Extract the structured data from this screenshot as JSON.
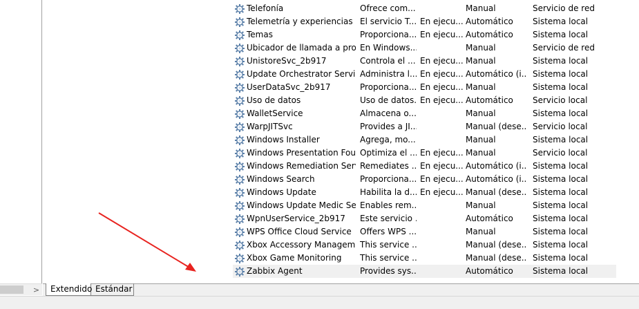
{
  "services": [
    {
      "name": "Telefonía",
      "description": "Ofrece com...",
      "state": "",
      "startup": "Manual",
      "logon": "Servicio de red"
    },
    {
      "name": "Telemetría y experiencias de...",
      "description": "El servicio T...",
      "state": "En ejecu...",
      "startup": "Automático",
      "logon": "Sistema local"
    },
    {
      "name": "Temas",
      "description": "Proporciona...",
      "state": "En ejecu...",
      "startup": "Automático",
      "logon": "Sistema local"
    },
    {
      "name": "Ubicador de llamada a proc...",
      "description": "En Windows...",
      "state": "",
      "startup": "Manual",
      "logon": "Servicio de red"
    },
    {
      "name": "UnistoreSvc_2b917",
      "description": "Controla el ...",
      "state": "En ejecu...",
      "startup": "Manual",
      "logon": "Sistema local"
    },
    {
      "name": "Update Orchestrator Service",
      "description": "Administra l...",
      "state": "En ejecu...",
      "startup": "Automático (i...",
      "logon": "Sistema local"
    },
    {
      "name": "UserDataSvc_2b917",
      "description": "Proporciona...",
      "state": "En ejecu...",
      "startup": "Manual",
      "logon": "Sistema local"
    },
    {
      "name": "Uso de datos",
      "description": "Uso de datos...",
      "state": "En ejecu...",
      "startup": "Automático",
      "logon": "Servicio local"
    },
    {
      "name": "WalletService",
      "description": "Almacena o...",
      "state": "",
      "startup": "Manual",
      "logon": "Sistema local"
    },
    {
      "name": "WarpJITSvc",
      "description": "Provides a JI...",
      "state": "",
      "startup": "Manual (dese...",
      "logon": "Servicio local"
    },
    {
      "name": "Windows Installer",
      "description": "Agrega, mo...",
      "state": "",
      "startup": "Manual",
      "logon": "Sistema local"
    },
    {
      "name": "Windows Presentation Fou...",
      "description": "Optimiza el ...",
      "state": "En ejecu...",
      "startup": "Manual",
      "logon": "Servicio local"
    },
    {
      "name": "Windows Remediation Servi...",
      "description": "Remediates ...",
      "state": "En ejecu...",
      "startup": "Automático (i...",
      "logon": "Sistema local"
    },
    {
      "name": "Windows Search",
      "description": "Proporciona...",
      "state": "En ejecu...",
      "startup": "Automático (i...",
      "logon": "Sistema local"
    },
    {
      "name": "Windows Update",
      "description": "Habilita la d...",
      "state": "En ejecu...",
      "startup": "Manual (dese...",
      "logon": "Sistema local"
    },
    {
      "name": "Windows Update Medic Ser...",
      "description": "Enables rem...",
      "state": "",
      "startup": "Manual",
      "logon": "Sistema local"
    },
    {
      "name": "WpnUserService_2b917",
      "description": "Este servicio ...",
      "state": "",
      "startup": "Automático",
      "logon": "Sistema local"
    },
    {
      "name": "WPS Office Cloud Service",
      "description": "Offers WPS ...",
      "state": "",
      "startup": "Manual",
      "logon": "Sistema local"
    },
    {
      "name": "Xbox Accessory Manageme...",
      "description": "This service ...",
      "state": "",
      "startup": "Manual (dese...",
      "logon": "Sistema local"
    },
    {
      "name": "Xbox Game Monitoring",
      "description": "This service ...",
      "state": "",
      "startup": "Manual (dese...",
      "logon": "Sistema local"
    },
    {
      "name": "Zabbix Agent",
      "description": "Provides sys...",
      "state": "",
      "startup": "Automático",
      "logon": "Sistema local",
      "selected": true
    }
  ],
  "tabs": {
    "extended": "Extendido",
    "standard": "Estándar"
  },
  "scrollbar": {
    "right_arrow": ">"
  },
  "icons": {
    "service": "gear-icon",
    "scroll_right": "chevron-right-icon",
    "annotation": "red-arrow"
  },
  "colors": {
    "arrow": "#e8231f",
    "selected_row": "#f0f0f0",
    "gear": "#5a7fa8"
  }
}
